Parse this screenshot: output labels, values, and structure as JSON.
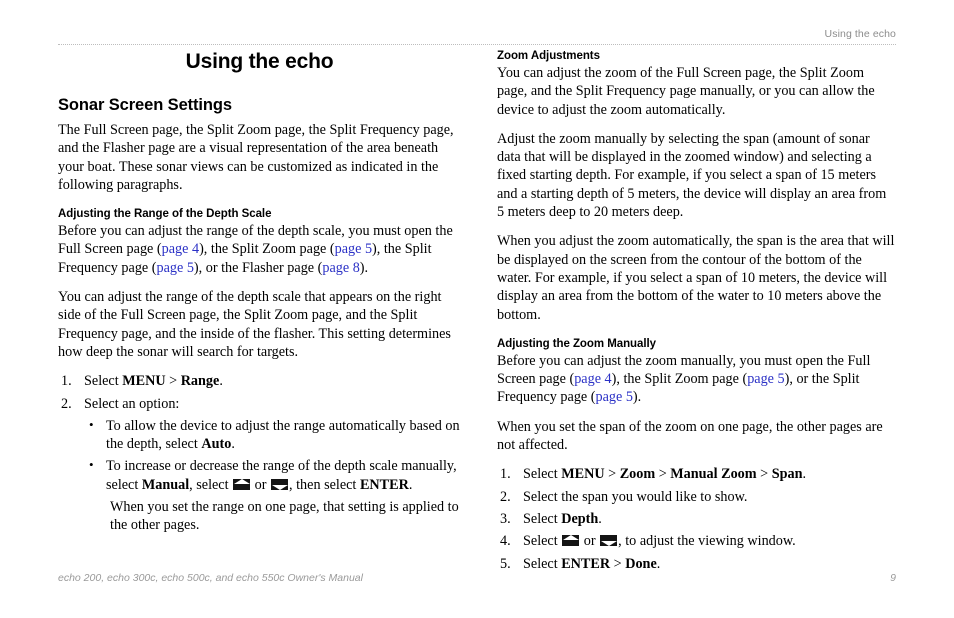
{
  "header": {
    "running_head": "Using the echo"
  },
  "left_column": {
    "chapter_title": "Using the echo",
    "section_title": "Sonar Screen Settings",
    "intro_paragraph": "The Full Screen page, the Split Zoom page, the Split Frequency page, and the Flasher page are a visual representation of the area beneath your boat. These sonar views can be customized as indicated in the following paragraphs.",
    "subsection": {
      "title": "Adjusting the Range of the Depth Scale",
      "intro_part1": "Before you can adjust the range of the depth scale, you must open the Full Screen page (",
      "link1": "page 4",
      "intro_part2": "), the Split Zoom page (",
      "link2": "page 5",
      "intro_part3": "), the Split Frequency page (",
      "link3": "page 5",
      "intro_part4": "), or the Flasher page (",
      "link4": "page 8",
      "intro_part5": ").",
      "paragraph2": "You can adjust the range of the depth scale that appears on the right side of the Full Screen page, the Split Zoom page, and the Split Frequency page, and the inside of the flasher. This setting determines how deep the sonar will search for targets.",
      "steps": [
        {
          "num": "1.",
          "pre": "Select ",
          "bold1": "MENU",
          "mid": " > ",
          "bold2": "Range",
          "post": "."
        },
        {
          "num": "2.",
          "pre": "Select an option:",
          "bold1": "",
          "mid": "",
          "bold2": "",
          "post": ""
        }
      ],
      "bullets": [
        {
          "dot": "•",
          "text_pre": "To allow the device to adjust the range automatically based on the depth, select ",
          "bold": "Auto",
          "text_post": "."
        }
      ],
      "bullet_manual": {
        "dot": "•",
        "line1": "To increase or decrease the range of the depth scale manually, select ",
        "bold1": "Manual",
        "mid1": ", select ",
        "icon_up": "up-arrow-key-icon",
        "or_text": " or ",
        "icon_down": "down-arrow-key-icon",
        "mid2": ", then select ",
        "bold2": "ENTER",
        "post": "."
      },
      "closing_paragraph": "When you set the range on one page, that setting is applied to the other pages."
    }
  },
  "right_column": {
    "section_title": "Zoom Adjustments",
    "paragraph1": "You can adjust the zoom of the Full Screen page, the Split Zoom page, and the Split Frequency page manually, or you can allow the device to adjust the zoom automatically.",
    "paragraph2": "Adjust the zoom manually by selecting the span (amount of sonar data that will be displayed in the zoomed window) and selecting a fixed starting depth. For example, if you select a span of 15 meters and a starting depth of 5 meters, the device will display an area from 5 meters deep to 20 meters deep.",
    "paragraph3": "When you adjust the zoom automatically, the span is the area that will be displayed on the screen from the contour of the bottom of the water. For example, if you select a span of 10 meters, the device will display an area from the bottom of the water to 10 meters above the bottom.",
    "subsection": {
      "title": "Adjusting the Zoom Manually",
      "intro_part1": "Before you can adjust the zoom manually, you must open the Full Screen page (",
      "link1": "page 4",
      "intro_part2": "), the Split Zoom page (",
      "link2": "page 5",
      "intro_part3": "), or the Split Frequency page (",
      "link3": "page 5",
      "intro_part4": ").",
      "paragraph2": "When you set the span of the zoom on one page, the other pages are not affected.",
      "steps": [
        {
          "num": "1.",
          "pre": "Select ",
          "bold1": "MENU",
          "sep1": " > ",
          "bold2": "Zoom",
          "sep2": " > ",
          "bold3": "Manual Zoom",
          "sep3": " > ",
          "bold4": "Span",
          "post": "."
        },
        {
          "num": "2.",
          "pre": "Select the span you would like to show.",
          "bold1": "",
          "sep1": "",
          "bold2": "",
          "sep2": "",
          "bold3": "",
          "sep3": "",
          "bold4": "",
          "post": ""
        },
        {
          "num": "3.",
          "pre": "Select ",
          "bold1": "Depth",
          "sep1": "",
          "bold2": "",
          "sep2": "",
          "bold3": "",
          "sep3": "",
          "bold4": "",
          "post": "."
        }
      ],
      "step4": {
        "num": "4.",
        "pre": "Select ",
        "icon_up": "up-arrow-key-icon",
        "or_text": " or ",
        "icon_down": "down-arrow-key-icon",
        "post": ", to adjust the viewing window."
      },
      "step5": {
        "num": "5.",
        "pre": "Select ",
        "bold1": "ENTER",
        "sep1": " > ",
        "bold2": "Done",
        "post": "."
      }
    }
  },
  "footer": {
    "manual_title": "echo 200, echo 300c, echo 500c, and echo 550c Owner's Manual",
    "page_number": "9"
  },
  "colors": {
    "link": "#2b31c6",
    "header_gray": "#8c8c8c",
    "footer_gray": "#9a9a9a",
    "rule": "#bdbdbd"
  }
}
